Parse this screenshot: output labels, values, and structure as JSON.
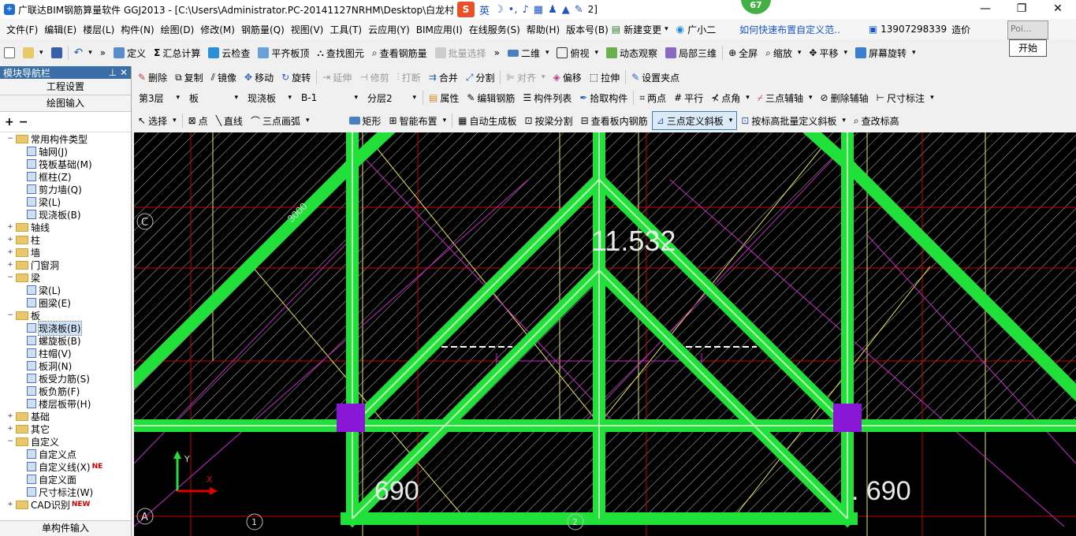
{
  "window": {
    "title": "广联达BIM钢筋算量软件 GGJ2013 - [C:\\Users\\Administrator.PC-20141127NRHM\\Desktop\\白龙村",
    "title_tail": "2]",
    "ime_lang": "英",
    "badge": "67"
  },
  "menu": {
    "items": [
      "文件(F)",
      "编辑(E)",
      "楼层(L)",
      "构件(N)",
      "绘图(D)",
      "修改(M)",
      "钢筋量(Q)",
      "视图(V)",
      "工具(T)",
      "云应用(Y)",
      "BIM应用(I)",
      "在线服务(S)",
      "帮助(H)",
      "版本号(B)"
    ],
    "new_change": "新建变更",
    "guang_xiaoer": "广小二",
    "hint_link": "如何快速布置自定义范..",
    "phone": "13907298339",
    "cost": "造价",
    "popup_text": "Poi...",
    "popup_button": "开始"
  },
  "toolbar1": {
    "define": "定义",
    "sum": "汇总计算",
    "cloud_check": "云检查",
    "align_top": "平齐板顶",
    "find": "查找图元",
    "view_rebar": "查看钢筋量",
    "batch_select": "批量选择",
    "view2d": "二维",
    "view_mode": "俯视",
    "dynamic": "动态观察",
    "local3d": "局部三维",
    "fullscreen": "全屏",
    "zoom": "缩放",
    "pan": "平移",
    "rotate_screen": "屏幕旋转"
  },
  "toolbar2": {
    "delete": "删除",
    "copy": "复制",
    "mirror": "镜像",
    "move": "移动",
    "rotate": "旋转",
    "extend": "延伸",
    "trim": "修剪",
    "break": "打断",
    "merge": "合并",
    "split": "分割",
    "align": "对齐",
    "offset": "偏移",
    "stretch": "拉伸",
    "set_grip": "设置夹点"
  },
  "toolbar3": {
    "floor": "第3层",
    "category": "板",
    "type": "现浇板",
    "name": "B-1",
    "layer": "分层2",
    "attr": "属性",
    "edit_rebar": "编辑钢筋",
    "comp_list": "构件列表",
    "pick": "拾取构件",
    "two_points": "两点",
    "parallel": "平行",
    "point_angle": "点角",
    "three_axis": "三点辅轴",
    "del_axis": "删除辅轴",
    "dim": "尺寸标注"
  },
  "toolbar4": {
    "select": "选择",
    "point": "点",
    "line": "直线",
    "arc": "三点画弧",
    "rect": "矩形",
    "smart": "智能布置",
    "auto_slab": "自动生成板",
    "beam_split": "按梁分割",
    "view_slab_rebar": "查看板内钢筋",
    "three_point_slope": "三点定义斜板",
    "batch_slope": "按标高批量定义斜板",
    "edit_elev": "查改标高"
  },
  "sidebar": {
    "header": "模块导航栏",
    "project_settings": "工程设置",
    "drawing_input": "绘图输入",
    "bottom": "单构件输入",
    "tree": [
      {
        "level": 0,
        "toggle": "−",
        "folder": true,
        "label": "常用构件类型"
      },
      {
        "level": 1,
        "label": "轴网(J)"
      },
      {
        "level": 1,
        "label": "筏板基础(M)"
      },
      {
        "level": 1,
        "label": "框柱(Z)"
      },
      {
        "level": 1,
        "label": "剪力墙(Q)"
      },
      {
        "level": 1,
        "label": "梁(L)"
      },
      {
        "level": 1,
        "label": "现浇板(B)"
      },
      {
        "level": 0,
        "toggle": "+",
        "folder": true,
        "label": "轴线"
      },
      {
        "level": 0,
        "toggle": "+",
        "folder": true,
        "label": "柱"
      },
      {
        "level": 0,
        "toggle": "+",
        "folder": true,
        "label": "墙"
      },
      {
        "level": 0,
        "toggle": "+",
        "folder": true,
        "label": "门窗洞"
      },
      {
        "level": 0,
        "toggle": "−",
        "folder": true,
        "label": "梁"
      },
      {
        "level": 1,
        "label": "梁(L)"
      },
      {
        "level": 1,
        "label": "圈梁(E)"
      },
      {
        "level": 0,
        "toggle": "−",
        "folder": true,
        "label": "板"
      },
      {
        "level": 1,
        "label": "现浇板(B)",
        "selected": true
      },
      {
        "level": 1,
        "label": "螺旋板(B)"
      },
      {
        "level": 1,
        "label": "柱帽(V)"
      },
      {
        "level": 1,
        "label": "板洞(N)"
      },
      {
        "level": 1,
        "label": "板受力筋(S)"
      },
      {
        "level": 1,
        "label": "板负筋(F)"
      },
      {
        "level": 1,
        "label": "楼层板带(H)"
      },
      {
        "level": 0,
        "toggle": "+",
        "folder": true,
        "label": "基础"
      },
      {
        "level": 0,
        "toggle": "+",
        "folder": true,
        "label": "其它"
      },
      {
        "level": 0,
        "toggle": "−",
        "folder": true,
        "label": "自定义"
      },
      {
        "level": 1,
        "label": "自定义点"
      },
      {
        "level": 1,
        "label": "自定义线(X)",
        "new": "NE"
      },
      {
        "level": 1,
        "label": "自定义面"
      },
      {
        "level": 1,
        "label": "尺寸标注(W)"
      },
      {
        "level": 0,
        "toggle": "+",
        "folder": true,
        "label": "CAD识别",
        "new": "NEW"
      }
    ]
  },
  "canvas": {
    "elev_center": "11.532",
    "elev_left": "690",
    "elev_right": ". 690",
    "dim_3000": "3000",
    "axis_c": "C",
    "axis_a": "A",
    "axis_1": "1",
    "axis_2": "2",
    "ucs_y": "Y",
    "ucs_x": "X"
  },
  "colors": {
    "beam": "#22e03a",
    "column": "#8a17d8",
    "grid": "#e00000",
    "hatch": "#c8c8c8",
    "magenta": "#d020d0",
    "yellow": "#e8e84a"
  }
}
